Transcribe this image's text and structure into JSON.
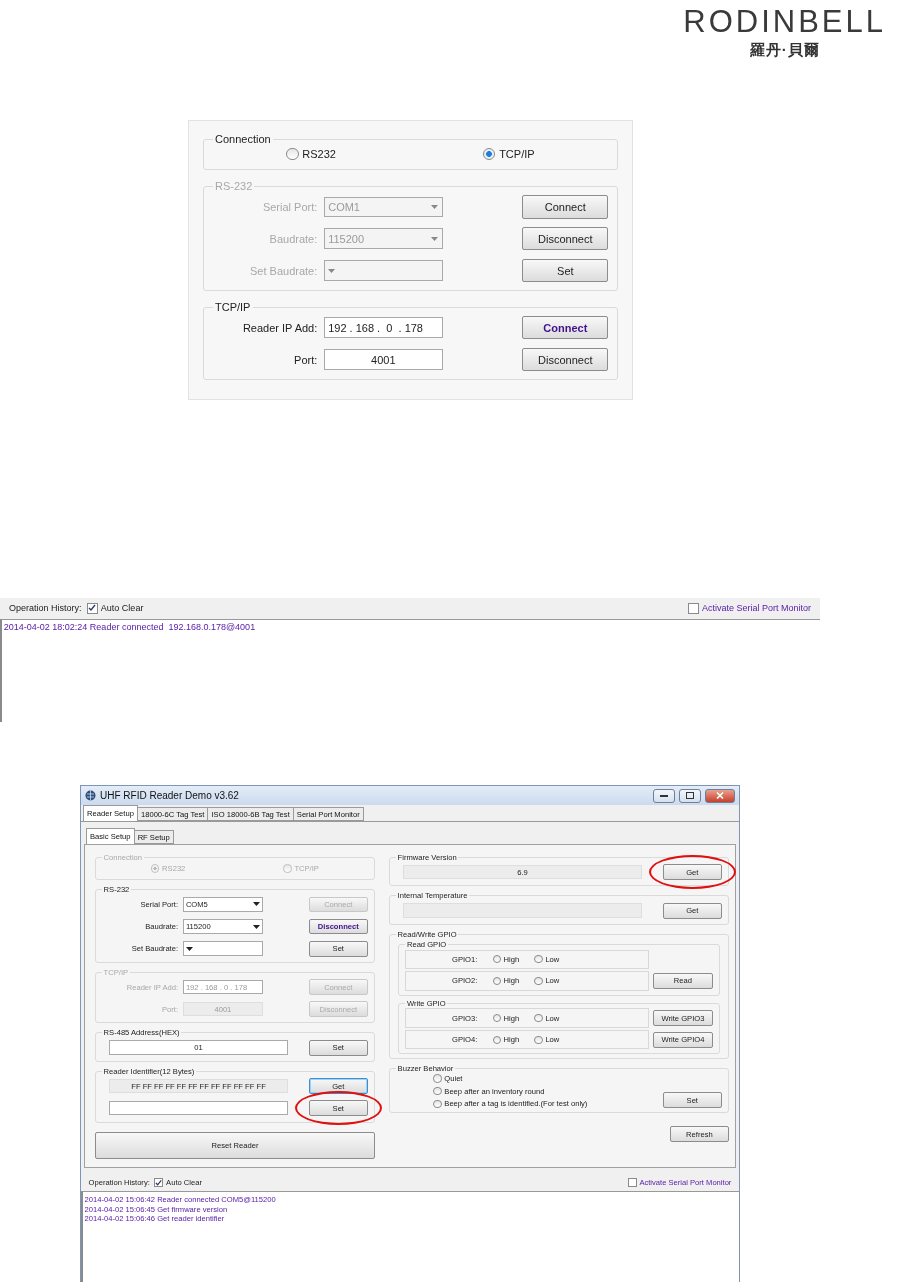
{
  "logo": {
    "wordmark": "RODINBELL",
    "subtitle": "羅丹·貝爾"
  },
  "connection_panel": {
    "connection": {
      "title": "Connection",
      "disabled": false,
      "options": [
        {
          "label": "RS232",
          "selected": false
        },
        {
          "label": "TCP/IP",
          "selected": true
        }
      ]
    },
    "groups": [
      {
        "title": "RS-232",
        "disabled": true,
        "rows": [
          {
            "label": "Serial Port:",
            "control": {
              "kind": "select",
              "value": "COM1"
            },
            "button": {
              "label": "Connect",
              "disabled": false,
              "emphasized": false
            }
          },
          {
            "label": "Baudrate:",
            "control": {
              "kind": "select",
              "value": "115200"
            },
            "button": {
              "label": "Disconnect",
              "disabled": false,
              "emphasized": false
            }
          },
          {
            "label": "Set Baudrate:",
            "control": {
              "kind": "select"
            },
            "button": {
              "label": "Set",
              "disabled": false,
              "emphasized": false
            }
          }
        ]
      },
      {
        "title": "TCP/IP",
        "disabled": false,
        "rows": [
          {
            "label": "Reader IP Add:",
            "control": {
              "kind": "ip",
              "value": "192 . 168 .  0  . 178"
            },
            "button": {
              "label": "Connect",
              "disabled": false,
              "emphasized": true
            }
          },
          {
            "label": "Port:",
            "control": {
              "kind": "text",
              "value": "4001"
            },
            "button": {
              "label": "Disconnect",
              "disabled": false,
              "emphasized": false
            }
          }
        ]
      }
    ]
  },
  "history_panel": {
    "label": "Operation History:",
    "auto_clear": {
      "label": "Auto Clear",
      "checked": true
    },
    "monitor": {
      "label": "Activate Serial Port Monitor",
      "checked": false
    },
    "log": [
      "2014-04-02 18:02:24 Reader connected  192.168.0.178@4001"
    ]
  },
  "app_window": {
    "title": "UHF RFID Reader Demo v3.62",
    "tabs": [
      {
        "label": "Reader Setup",
        "selected": true
      },
      {
        "label": "18000-6C Tag Test",
        "selected": false
      },
      {
        "label": "ISO 18000-6B Tag Test",
        "selected": false
      },
      {
        "label": "Serial Port Monitor",
        "selected": false
      }
    ],
    "subtabs": [
      {
        "label": "Basic Setup",
        "selected": true
      },
      {
        "label": "RF Setup",
        "selected": false
      }
    ],
    "left": {
      "connection": {
        "title": "Connection",
        "disabled": true,
        "options": [
          {
            "label": "RS232",
            "selected": true
          },
          {
            "label": "TCP/IP",
            "selected": false
          }
        ]
      },
      "groups": [
        {
          "title": "RS-232",
          "disabled": false,
          "rows": [
            {
              "label": "Serial Port:",
              "control": {
                "kind": "select",
                "value": "COM5"
              },
              "button": {
                "label": "Connect",
                "disabled": true,
                "emphasized": false,
                "focused": false
              }
            },
            {
              "label": "Baudrate:",
              "control": {
                "kind": "select",
                "value": "115200"
              },
              "button": {
                "label": "Disconnect",
                "disabled": false,
                "emphasized": true,
                "focused": false
              }
            },
            {
              "label": "Set Baudrate:",
              "control": {
                "kind": "select"
              },
              "button": {
                "label": "Set",
                "disabled": false,
                "emphasized": false,
                "focused": false
              }
            }
          ]
        },
        {
          "title": "TCP/IP",
          "disabled": true,
          "rows": [
            {
              "label": "Reader IP Add:",
              "control": {
                "kind": "ip",
                "value": "192 . 168 . 0 . 178"
              },
              "button": {
                "label": "Connect",
                "disabled": true,
                "emphasized": false,
                "focused": false
              }
            },
            {
              "label": "Port:",
              "control": {
                "kind": "readonly",
                "value": "4001"
              },
              "button": {
                "label": "Disconnect",
                "disabled": true,
                "emphasized": false,
                "focused": false
              }
            }
          ]
        },
        {
          "title": "RS-485 Address(HEX)",
          "disabled": false,
          "rows": [
            {
              "control": {
                "kind": "text",
                "value": "01"
              },
              "button": {
                "label": "Set",
                "disabled": false,
                "emphasized": false,
                "focused": false
              }
            }
          ]
        },
        {
          "title": "Reader Identifier(12 Bytes)",
          "disabled": false,
          "rows": [
            {
              "control": {
                "kind": "readonly",
                "value": "FF FF FF FF FF FF FF FF FF FF FF FF"
              },
              "button": {
                "label": "Get",
                "disabled": false,
                "emphasized": false,
                "focused": true
              }
            },
            {
              "control": {
                "kind": "text"
              },
              "button": {
                "label": "Set",
                "disabled": false,
                "emphasized": false,
                "focused": false,
                "highlighted": true
              }
            }
          ]
        }
      ],
      "reset_button": {
        "label": "Reset Reader"
      }
    },
    "right": {
      "groups": [
        {
          "title": "Firmware Version",
          "disabled": false,
          "rows": [
            {
              "control": {
                "kind": "readonly",
                "value": "6.9"
              },
              "button": {
                "label": "Get",
                "disabled": false,
                "emphasized": false,
                "focused": false,
                "highlighted": true
              }
            }
          ]
        },
        {
          "title": "Internal Temperature",
          "disabled": false,
          "rows": [
            {
              "control": {
                "kind": "readonly"
              },
              "button": {
                "label": "Get",
                "disabled": false,
                "emphasized": false,
                "focused": false
              }
            }
          ]
        }
      ],
      "gpio": {
        "title": "Read/Write GPIO",
        "sections": [
          {
            "title": "Read GPIO",
            "rows": [
              {
                "label": "GPIO1:",
                "options": [
                  {
                    "label": "High",
                    "selected": false
                  },
                  {
                    "label": "Low",
                    "selected": false
                  }
                ]
              },
              {
                "label": "GPIO2:",
                "options": [
                  {
                    "label": "High",
                    "selected": false
                  },
                  {
                    "label": "Low",
                    "selected": false
                  }
                ],
                "button": {
                  "label": "Read"
                }
              }
            ]
          },
          {
            "title": "Write GPIO",
            "rows": [
              {
                "label": "GPIO3:",
                "options": [
                  {
                    "label": "High",
                    "selected": false
                  },
                  {
                    "label": "Low",
                    "selected": false
                  }
                ],
                "button": {
                  "label": "Write GPIO3"
                }
              },
              {
                "label": "GPIO4:",
                "options": [
                  {
                    "label": "High",
                    "selected": false
                  },
                  {
                    "label": "Low",
                    "selected": false
                  }
                ],
                "button": {
                  "label": "Write GPIO4"
                }
              }
            ]
          }
        ]
      },
      "buzzer": {
        "title": "Buzzer Behavior",
        "options": [
          {
            "label": "Quiet",
            "selected": false
          },
          {
            "label": "Beep after an inventory round",
            "selected": false
          },
          {
            "label": "Beep after a tag is identified.(For test only)",
            "selected": false
          }
        ],
        "button": {
          "label": "Set"
        }
      },
      "refresh_button": {
        "label": "Refresh"
      }
    },
    "history": {
      "label": "Operation History:",
      "auto_clear": {
        "label": "Auto Clear",
        "checked": true
      },
      "monitor": {
        "label": "Activate Serial Port Monitor",
        "checked": false
      },
      "log": [
        "2014-04-02 15:06:42 Reader connected COM5@115200",
        "2014-04-02 15:06:45 Get firmware version",
        "2014-04-02 15:06:46 Get reader identifier"
      ]
    }
  }
}
